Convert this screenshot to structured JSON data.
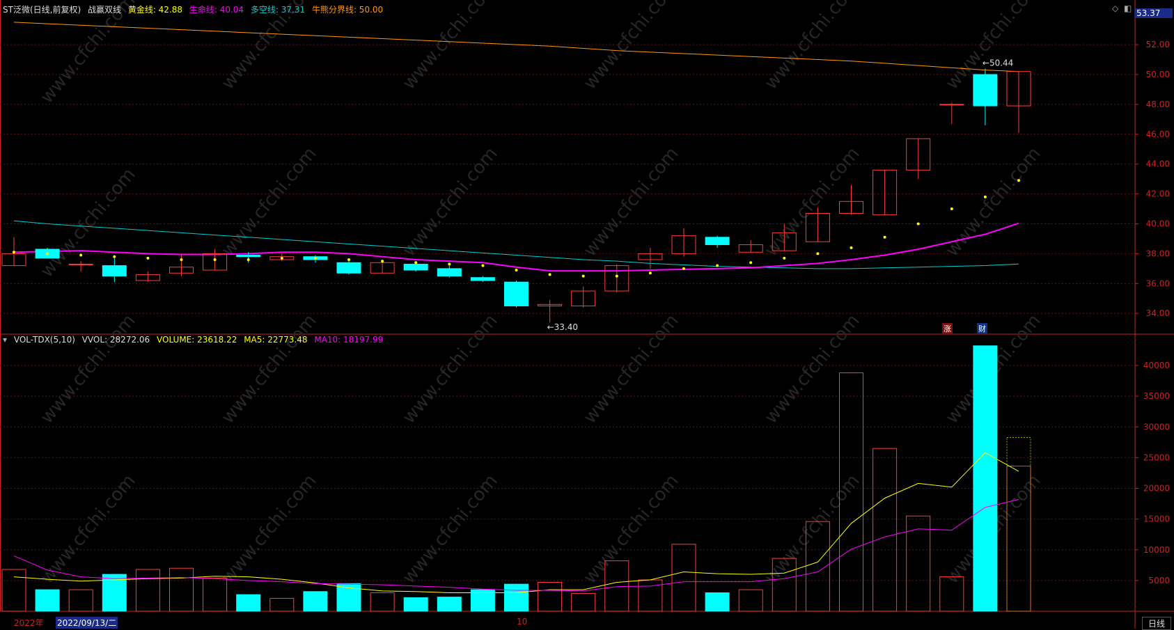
{
  "header": {
    "title": "ST泛微(日线,前复权)",
    "indicator": "战赢双线",
    "gold_label": "黄金线: 42.88",
    "life_label": "生命线: 40.04",
    "bullbear_label": "多空线: 37.31",
    "boundary_label": "牛熊分界线: 50.00",
    "price_tag": "53.37"
  },
  "volume_header": {
    "name": "VOL-TDX(5,10)",
    "vvol": "VVOL: 28272.06",
    "volume": "VOLUME: 23618.22",
    "ma5": "MA5: 22773.48",
    "ma10": "MA10: 18197.99"
  },
  "footer": {
    "year": "2022年",
    "date_cursor": "2022/09/13/二",
    "month_mark": "10",
    "period_button": "日线"
  },
  "markers": {
    "zhang": "涨",
    "cai": "财"
  },
  "watermark": "www.cfchi.com",
  "colors": {
    "up": "#ff3b3b",
    "down": "#00ffff",
    "gold": "#ffff00",
    "life": "#ff00ff",
    "bullbear": "#00d0d0",
    "boundary": "#ff9900",
    "axis": "#cc2222"
  },
  "chart_data": [
    {
      "type": "candlestick",
      "title": "ST泛微(日线,前复权)",
      "ylim": [
        33,
        54
      ],
      "yticks": [
        34,
        36,
        38,
        40,
        42,
        44,
        46,
        48,
        50,
        52
      ],
      "annotations": [
        {
          "text": "50.44",
          "index": 29
        },
        {
          "text": "33.40",
          "index": 16
        }
      ],
      "candles": [
        {
          "o": 37.2,
          "h": 39.1,
          "l": 37.2,
          "c": 38.0
        },
        {
          "o": 38.3,
          "h": 38.4,
          "l": 37.7,
          "c": 37.7
        },
        {
          "o": 37.3,
          "h": 37.5,
          "l": 36.8,
          "c": 37.3
        },
        {
          "o": 37.2,
          "h": 37.7,
          "l": 36.1,
          "c": 36.5
        },
        {
          "o": 36.2,
          "h": 36.8,
          "l": 36.1,
          "c": 36.6
        },
        {
          "o": 36.7,
          "h": 37.9,
          "l": 36.5,
          "c": 37.1
        },
        {
          "o": 36.9,
          "h": 38.3,
          "l": 36.9,
          "c": 38.0
        },
        {
          "o": 37.9,
          "h": 38.1,
          "l": 37.4,
          "c": 37.8
        },
        {
          "o": 37.6,
          "h": 38.0,
          "l": 37.5,
          "c": 37.8
        },
        {
          "o": 37.8,
          "h": 37.9,
          "l": 37.4,
          "c": 37.6
        },
        {
          "o": 37.4,
          "h": 37.6,
          "l": 36.6,
          "c": 36.7
        },
        {
          "o": 36.7,
          "h": 37.5,
          "l": 36.7,
          "c": 37.4
        },
        {
          "o": 37.3,
          "h": 37.5,
          "l": 36.8,
          "c": 36.9
        },
        {
          "o": 37.0,
          "h": 37.2,
          "l": 36.4,
          "c": 36.5
        },
        {
          "o": 36.4,
          "h": 36.5,
          "l": 36.1,
          "c": 36.2
        },
        {
          "o": 36.1,
          "h": 36.2,
          "l": 34.4,
          "c": 34.5
        },
        {
          "o": 34.5,
          "h": 34.9,
          "l": 33.4,
          "c": 34.6
        },
        {
          "o": 34.5,
          "h": 35.8,
          "l": 34.4,
          "c": 35.5
        },
        {
          "o": 35.5,
          "h": 37.3,
          "l": 35.4,
          "c": 37.2
        },
        {
          "o": 37.6,
          "h": 38.4,
          "l": 37.0,
          "c": 38.0
        },
        {
          "o": 38.0,
          "h": 39.7,
          "l": 37.8,
          "c": 39.2
        },
        {
          "o": 39.1,
          "h": 39.2,
          "l": 38.4,
          "c": 38.6
        },
        {
          "o": 38.1,
          "h": 38.9,
          "l": 38.1,
          "c": 38.6
        },
        {
          "o": 38.2,
          "h": 40.0,
          "l": 38.2,
          "c": 39.4
        },
        {
          "o": 38.8,
          "h": 41.1,
          "l": 38.8,
          "c": 40.7
        },
        {
          "o": 40.7,
          "h": 42.6,
          "l": 40.6,
          "c": 41.5
        },
        {
          "o": 40.6,
          "h": 43.6,
          "l": 40.6,
          "c": 43.6
        },
        {
          "o": 43.6,
          "h": 45.7,
          "l": 43.0,
          "c": 45.7
        },
        {
          "o": 48.0,
          "h": 48.1,
          "l": 46.7,
          "c": 48.0
        },
        {
          "o": 50.0,
          "h": 50.4,
          "l": 46.6,
          "c": 47.9
        },
        {
          "o": 47.9,
          "h": 50.2,
          "l": 46.1,
          "c": 50.2
        }
      ],
      "series": [
        {
          "name": "黄金线",
          "values": [
            38.1,
            38.0,
            37.9,
            37.8,
            37.7,
            37.6,
            37.6,
            37.6,
            37.7,
            37.7,
            37.6,
            37.5,
            37.4,
            37.3,
            37.2,
            36.9,
            36.6,
            36.5,
            36.5,
            36.7,
            37.0,
            37.2,
            37.4,
            37.7,
            38.0,
            38.4,
            39.1,
            40.0,
            41.0,
            41.8,
            42.9
          ]
        },
        {
          "name": "生命线",
          "values": [
            38.1,
            38.15,
            38.2,
            38.1,
            38.0,
            37.95,
            37.95,
            38.0,
            38.1,
            38.1,
            38.0,
            37.8,
            37.6,
            37.5,
            37.4,
            37.1,
            36.85,
            36.85,
            36.85,
            36.9,
            36.95,
            37.0,
            37.05,
            37.2,
            37.35,
            37.6,
            37.9,
            38.3,
            38.8,
            39.3,
            40.04
          ]
        },
        {
          "name": "多空线",
          "values": [
            40.2,
            40.0,
            39.85,
            39.7,
            39.55,
            39.4,
            39.25,
            39.1,
            38.95,
            38.8,
            38.65,
            38.5,
            38.35,
            38.2,
            38.05,
            37.9,
            37.75,
            37.6,
            37.5,
            37.35,
            37.25,
            37.15,
            37.1,
            37.05,
            37.0,
            37.0,
            37.05,
            37.1,
            37.15,
            37.2,
            37.31
          ]
        },
        {
          "name": "牛熊分界线",
          "values": [
            53.5,
            53.4,
            53.3,
            53.2,
            53.1,
            53.0,
            52.9,
            52.8,
            52.7,
            52.6,
            52.5,
            52.4,
            52.3,
            52.2,
            52.1,
            52.0,
            51.9,
            51.75,
            51.6,
            51.5,
            51.4,
            51.3,
            51.2,
            51.1,
            51.0,
            50.9,
            50.75,
            50.6,
            50.45,
            50.3,
            50.2
          ]
        }
      ]
    },
    {
      "type": "bar",
      "title": "VOL-TDX(5,10)",
      "ylim": [
        0,
        45000
      ],
      "yticks": [
        5000,
        10000,
        15000,
        20000,
        25000,
        30000,
        35000,
        40000
      ],
      "values": [
        6800,
        3500,
        3500,
        6000,
        6800,
        7000,
        5400,
        2700,
        2100,
        3200,
        4500,
        3000,
        2200,
        2300,
        3500,
        4400,
        4700,
        2900,
        8200,
        5100,
        10900,
        3000,
        3500,
        8600,
        14600,
        38800,
        26500,
        15500,
        5600,
        43200,
        23618
      ],
      "ghost_value": 28272,
      "series": [
        {
          "name": "MA5",
          "values": [
            5600,
            5200,
            4900,
            5100,
            5300,
            5400,
            5700,
            5600,
            5200,
            4600,
            3800,
            3300,
            3200,
            3000,
            3000,
            3000,
            3500,
            3500,
            4700,
            5100,
            6400,
            6100,
            6000,
            6200,
            8000,
            14300,
            18400,
            20800,
            20200,
            25800,
            22773
          ]
        },
        {
          "name": "MA10",
          "values": [
            9000,
            6700,
            5600,
            5300,
            5400,
            5500,
            5300,
            5000,
            4800,
            4500,
            4400,
            4300,
            4100,
            3900,
            3600,
            3400,
            3400,
            3300,
            4000,
            4100,
            4800,
            4800,
            4800,
            5300,
            6400,
            10100,
            12100,
            13400,
            13200,
            16900,
            18198
          ]
        }
      ]
    }
  ]
}
